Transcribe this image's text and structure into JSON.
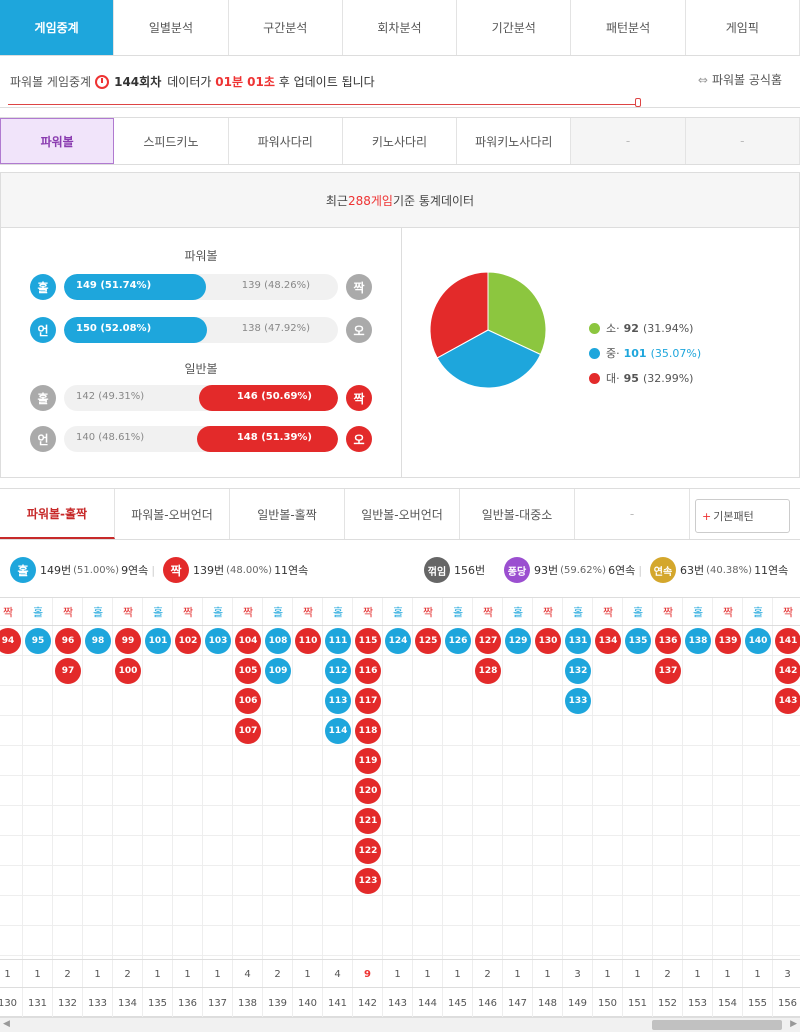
{
  "top_tabs": [
    "게임중계",
    "일별분석",
    "구간분석",
    "회차분석",
    "기간분석",
    "패턴분석",
    "게임픽"
  ],
  "status": {
    "label": "파워볼 게임중계",
    "round": "144회차",
    "text1": "데이터가",
    "time": "01분 01초",
    "text2": "후 업데이트 됩니다",
    "official_link": "파워볼 공식홈"
  },
  "sub_tabs": [
    "파워볼",
    "스피드키노",
    "파워사다리",
    "키노사다리",
    "파워키노사다리",
    "-",
    "-"
  ],
  "stat_header": {
    "prefix": "최근 ",
    "count": "288게임",
    "suffix": " 기준 통계데이터"
  },
  "powerball": {
    "title": "파워볼",
    "rows": [
      {
        "left_icon": "홀",
        "left_text": "149 (51.74%)",
        "right_text": "139 (48.26%)",
        "right_icon": "짝",
        "ratio": 0.5174
      },
      {
        "left_icon": "언",
        "left_text": "150 (52.08%)",
        "right_text": "138 (47.92%)",
        "right_icon": "오",
        "ratio": 0.5208
      }
    ]
  },
  "normalball": {
    "title": "일반볼",
    "rows": [
      {
        "left_icon": "홀",
        "left_text": "142 (49.31%)",
        "right_text": "146 (50.69%)",
        "right_icon": "짝",
        "ratio": 0.5069
      },
      {
        "left_icon": "언",
        "left_text": "140 (48.61%)",
        "right_text": "148 (51.39%)",
        "right_icon": "오",
        "ratio": 0.5139
      }
    ]
  },
  "chart_data": {
    "type": "pie",
    "slices": [
      {
        "label": "소",
        "value": 92,
        "pct": "(31.94%)",
        "color": "#8cc63f"
      },
      {
        "label": "중",
        "value": 101,
        "pct": "(35.07%)",
        "color": "#1ea6dc"
      },
      {
        "label": "대",
        "value": 95,
        "pct": "(32.99%)",
        "color": "#e32a2a"
      }
    ]
  },
  "pattern_tabs": [
    "파워볼-홀짝",
    "파워볼-오버언더",
    "일반볼-홀짝",
    "일반볼-오버언더",
    "일반볼-대중소",
    "-"
  ],
  "pattern_button": "기본패턴",
  "summary": {
    "odd": {
      "icon": "홀",
      "count": "149번",
      "pct": "(51.00%)",
      "streak": "9연속"
    },
    "even": {
      "icon": "짝",
      "count": "139번",
      "pct": "(48.00%)",
      "streak": "11연속"
    },
    "break": {
      "icon": "꺾임",
      "count": "156번"
    },
    "pong": {
      "icon": "퐁당",
      "count": "93번",
      "pct": "(59.62%)",
      "streak": "6연속"
    },
    "cont": {
      "icon": "연속",
      "count": "63번",
      "pct": "(40.38%)",
      "streak": "11연속"
    }
  },
  "colors": {
    "odd": "#1ea6dc",
    "even": "#e32a2a",
    "break": "#666666",
    "pong": "#9b4fd0",
    "cont": "#d4a72c"
  },
  "columns": [
    {
      "type": "짝",
      "balls": [
        94
      ]
    },
    {
      "type": "홀",
      "balls": [
        95
      ]
    },
    {
      "type": "짝",
      "balls": [
        96,
        97
      ]
    },
    {
      "type": "홀",
      "balls": [
        98
      ]
    },
    {
      "type": "짝",
      "balls": [
        99,
        100
      ]
    },
    {
      "type": "홀",
      "balls": [
        101
      ]
    },
    {
      "type": "짝",
      "balls": [
        102
      ]
    },
    {
      "type": "홀",
      "balls": [
        103
      ]
    },
    {
      "type": "짝",
      "balls": [
        104,
        105,
        106,
        107
      ]
    },
    {
      "type": "홀",
      "balls": [
        108,
        109
      ]
    },
    {
      "type": "짝",
      "balls": [
        110
      ]
    },
    {
      "type": "홀",
      "balls": [
        111,
        112,
        113,
        114
      ]
    },
    {
      "type": "짝",
      "balls": [
        115,
        116,
        117,
        118,
        119,
        120,
        121,
        122,
        123
      ]
    },
    {
      "type": "홀",
      "balls": [
        124
      ]
    },
    {
      "type": "짝",
      "balls": [
        125
      ]
    },
    {
      "type": "홀",
      "balls": [
        126
      ]
    },
    {
      "type": "짝",
      "balls": [
        127,
        128
      ]
    },
    {
      "type": "홀",
      "balls": [
        129
      ]
    },
    {
      "type": "짝",
      "balls": [
        130
      ]
    },
    {
      "type": "홀",
      "balls": [
        131,
        132,
        133
      ]
    },
    {
      "type": "짝",
      "balls": [
        134
      ]
    },
    {
      "type": "홀",
      "balls": [
        135
      ]
    },
    {
      "type": "짝",
      "balls": [
        136,
        137
      ]
    },
    {
      "type": "홀",
      "balls": [
        138
      ]
    },
    {
      "type": "짝",
      "balls": [
        139
      ]
    },
    {
      "type": "홀",
      "balls": [
        140
      ]
    },
    {
      "type": "짝",
      "balls": [
        141,
        142,
        143
      ]
    }
  ],
  "counts": [
    "1",
    "1",
    "2",
    "1",
    "2",
    "1",
    "1",
    "1",
    "4",
    "2",
    "1",
    "4",
    "9",
    "1",
    "1",
    "1",
    "2",
    "1",
    "1",
    "3",
    "1",
    "1",
    "2",
    "1",
    "1",
    "1",
    "3"
  ],
  "col_numbers": [
    "130",
    "131",
    "132",
    "133",
    "134",
    "135",
    "136",
    "137",
    "138",
    "139",
    "140",
    "141",
    "142",
    "143",
    "144",
    "145",
    "146",
    "147",
    "148",
    "149",
    "150",
    "151",
    "152",
    "153",
    "154",
    "155",
    "156"
  ]
}
